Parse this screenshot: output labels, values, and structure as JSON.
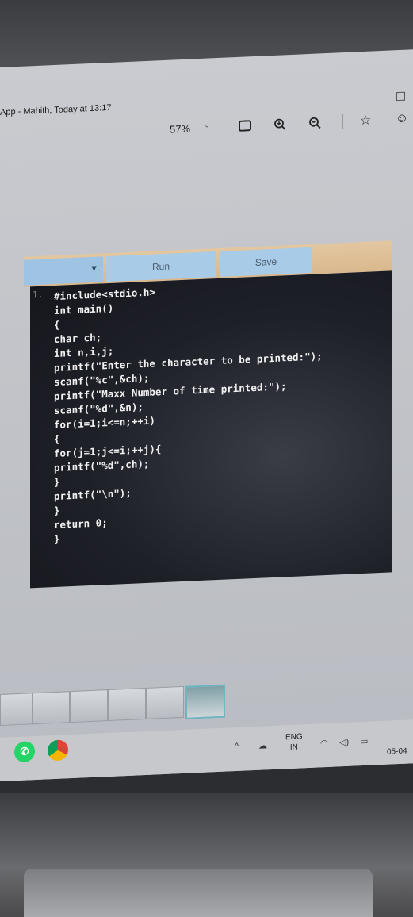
{
  "window": {
    "title": "App - Mahith, Today at 13:17"
  },
  "viewer_toolbar": {
    "zoom": "57%",
    "icons": [
      "fit-screen-icon",
      "zoom-in-icon",
      "zoom-out-icon",
      "favorite-star-icon",
      "feedback-smiley-icon"
    ]
  },
  "editor": {
    "run_label": "Run",
    "save_label": "Save",
    "line_number": "1.",
    "code_lines": [
      "#include<stdio.h>",
      "int main()",
      "{",
      "char ch;",
      "int n,i,j;",
      "printf(\"Enter the character to be printed:\");",
      "scanf(\"%c\",&ch);",
      "printf(\"Maxx Number of time printed:\");",
      "scanf(\"%d\",&n);",
      "for(i=1;i<=n;++i)",
      "{",
      "for(j=1;j<=i;++j){",
      "printf(\"%d\",ch);",
      "}",
      "printf(\"\\n\");",
      "}",
      "return 0;",
      "}"
    ]
  },
  "taskbar": {
    "apps": [
      "whatsapp-icon",
      "chrome-icon"
    ],
    "language_line1": "ENG",
    "language_line2": "IN",
    "date": "05-04",
    "colors": {
      "whatsapp": "#25d366",
      "chrome": "#db4437"
    }
  }
}
